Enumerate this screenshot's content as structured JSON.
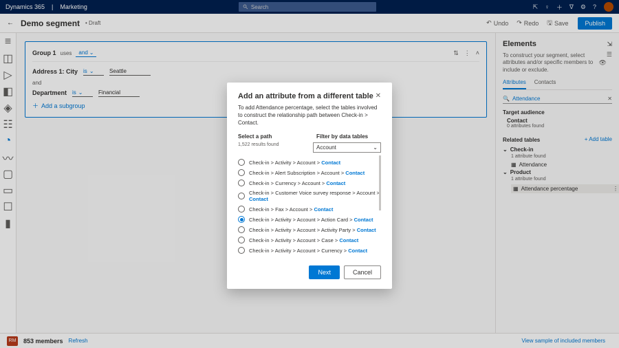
{
  "header": {
    "brand": "Dynamics 365",
    "suite": "Marketing",
    "search_placeholder": "Search"
  },
  "cmdbar": {
    "title": "Demo segment",
    "status": "• Draft",
    "undo": "Undo",
    "redo": "Redo",
    "save": "Save",
    "publish": "Publish"
  },
  "builder": {
    "group_label": "Group 1",
    "group_count": "uses",
    "group_op": "and",
    "row1_field": "Address 1: City",
    "row1_op": "is",
    "row1_val": "Seattle",
    "and": "and",
    "row2_field": "Department",
    "row2_op": "is",
    "row2_val": "Financial",
    "add_subgroup": "Add a subgroup"
  },
  "rpanel": {
    "title": "Elements",
    "desc": "To construct your segment, select attributes and/or specific members to include or exclude.",
    "tab_attr": "Attributes",
    "tab_contacts": "Contacts",
    "search_value": "Attendance",
    "target_heading": "Target audience",
    "target_entity": "Contact",
    "target_count": "0 attributes found",
    "related_heading": "Related tables",
    "add_table": "+ Add table",
    "node_checkin": "Check-in",
    "checkin_count": "1 attribute found",
    "checkin_attr": "Attendance",
    "node_product": "Product",
    "product_count": "1 attribute found",
    "product_attr": "Attendance percentage"
  },
  "footer": {
    "tag": "RM",
    "members": "853 members",
    "refresh": "Refresh",
    "view": "View sample of included members"
  },
  "modal": {
    "title": "Add an attribute from a different table",
    "desc": "To add Attendance percentage, select the tables involved to construct the relationship path between Check-in > Contact.",
    "select_path": "Select a path",
    "results": "1,522 results found",
    "filter_label": "Filter by data tables",
    "filter_value": "Account",
    "paths": [
      {
        "parts": [
          "Check-in",
          "Activity",
          "Account"
        ],
        "last": "Contact",
        "selected": false
      },
      {
        "parts": [
          "Check-in",
          "Alert Subscription",
          "Account"
        ],
        "last": "Contact",
        "selected": false
      },
      {
        "parts": [
          "Check-in",
          "Currency",
          "Account"
        ],
        "last": "Contact",
        "selected": false
      },
      {
        "parts": [
          "Check-in",
          "Customer Voice survey response",
          "Account"
        ],
        "last": "Contact",
        "selected": false
      },
      {
        "parts": [
          "Check-in",
          "Fax",
          "Account"
        ],
        "last": "Contact",
        "selected": false
      },
      {
        "parts": [
          "Check-in",
          "Activity",
          "Account",
          "Action Card"
        ],
        "last": "Contact",
        "selected": true
      },
      {
        "parts": [
          "Check-in",
          "Activity",
          "Account",
          "Activity Party"
        ],
        "last": "Contact",
        "selected": false
      },
      {
        "parts": [
          "Check-in",
          "Activity",
          "Account",
          "Case"
        ],
        "last": "Contact",
        "selected": false
      },
      {
        "parts": [
          "Check-in",
          "Activity",
          "Account",
          "Currency"
        ],
        "last": "Contact",
        "selected": false
      }
    ],
    "next": "Next",
    "cancel": "Cancel"
  }
}
